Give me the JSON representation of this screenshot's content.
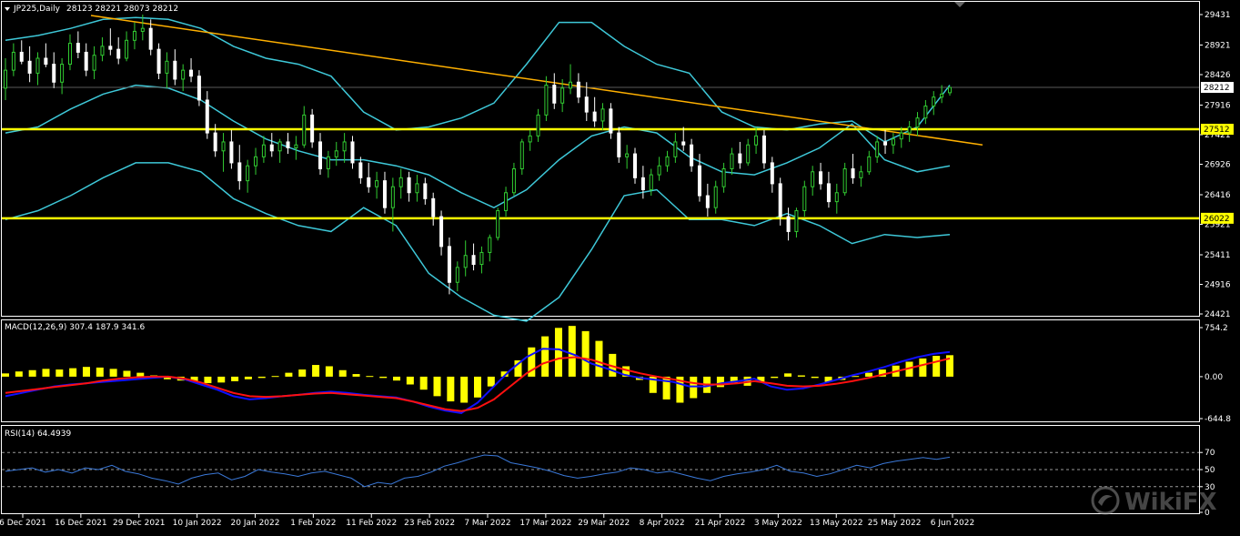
{
  "colors": {
    "bull": "#32cd32",
    "bear": "#ffffff",
    "bands": "#3ec8d8",
    "trendline": "#ffb000",
    "hline": "#ffff00",
    "macd_hist": "#ffff00",
    "macd_line": "#1010ff",
    "macd_signal": "#ff1010",
    "rsi": "#3a78d8",
    "border": "#ffffff"
  },
  "main_header": {
    "symbol": "JP225,Daily",
    "ohlc": "28123 28221 28073 28212"
  },
  "macd_header": {
    "label": "MACD(12,26,9) 307.4 187.9 341.6"
  },
  "rsi_header": {
    "label": "RSI(14) 64.4939"
  },
  "price_axis": [
    "29431",
    "28921",
    "28426",
    "27916",
    "27421",
    "26926",
    "26416",
    "25921",
    "25411",
    "24916",
    "24421"
  ],
  "current_price_tag": "28212",
  "hline_tags": [
    "27512",
    "26022"
  ],
  "macd_axis": [
    "754.2",
    "0.00",
    "-644.8"
  ],
  "rsi_axis": [
    "70",
    "50",
    "30",
    "0"
  ],
  "date_axis": [
    "6 Dec 2021",
    "16 Dec 2021",
    "29 Dec 2021",
    "10 Jan 2022",
    "20 Jan 2022",
    "1 Feb 2022",
    "11 Feb 2022",
    "23 Feb 2022",
    "7 Mar 2022",
    "17 Mar 2022",
    "29 Mar 2022",
    "8 Apr 2022",
    "21 Apr 2022",
    "3 May 2022",
    "13 May 2022",
    "25 May 2022",
    "6 Jun 2022"
  ],
  "watermark": "WikiFX",
  "chart_data": [
    {
      "type": "candlestick",
      "symbol": "JP225",
      "timeframe": "Daily",
      "ylim": [
        24421,
        29431
      ],
      "overlays": [
        "Bollinger Bands",
        "Trendline",
        "Horizontal lines 27512 and 26022"
      ],
      "horizontal_lines": [
        27512,
        26022
      ],
      "trendline": {
        "from": [
          "16 Dec 2021",
          29431
        ],
        "to": [
          "8 Jun 2022",
          27250
        ]
      },
      "bollinger": {
        "upper": [
          29000,
          29080,
          29200,
          29350,
          29380,
          29350,
          29200,
          28900,
          28700,
          28600,
          28400,
          27800,
          27500,
          27550,
          27700,
          27950,
          28600,
          29300,
          29300,
          28900,
          28600,
          28450,
          27800,
          27550,
          27500,
          27600,
          27650,
          27300,
          27550,
          28250
        ],
        "middle": [
          27450,
          27550,
          27850,
          28100,
          28250,
          28200,
          28000,
          27650,
          27350,
          27150,
          27000,
          27000,
          26900,
          26750,
          26450,
          26200,
          26500,
          27000,
          27400,
          27550,
          27450,
          27050,
          26800,
          26750,
          26950,
          27200,
          27600,
          27000,
          26800,
          26900
        ],
        "lower": [
          26000,
          26150,
          26400,
          26700,
          26950,
          26950,
          26800,
          26350,
          26100,
          25900,
          25800,
          26200,
          25900,
          25100,
          24700,
          24400,
          24300,
          24700,
          25500,
          26400,
          26500,
          26000,
          26000,
          25900,
          26100,
          25900,
          25600,
          25750,
          25700,
          25750
        ]
      },
      "candles": [
        {
          "o": 28200,
          "h": 28700,
          "l": 28000,
          "c": 28500
        },
        {
          "o": 28500,
          "h": 28950,
          "l": 28400,
          "c": 28800
        },
        {
          "o": 28800,
          "h": 29000,
          "l": 28600,
          "c": 28650
        },
        {
          "o": 28650,
          "h": 28900,
          "l": 28300,
          "c": 28450
        },
        {
          "o": 28450,
          "h": 28800,
          "l": 28250,
          "c": 28700
        },
        {
          "o": 28700,
          "h": 28950,
          "l": 28550,
          "c": 28600
        },
        {
          "o": 28600,
          "h": 28800,
          "l": 28200,
          "c": 28300
        },
        {
          "o": 28300,
          "h": 28700,
          "l": 28100,
          "c": 28600
        },
        {
          "o": 28600,
          "h": 29100,
          "l": 28500,
          "c": 28950
        },
        {
          "o": 28950,
          "h": 29150,
          "l": 28700,
          "c": 28800
        },
        {
          "o": 28800,
          "h": 28950,
          "l": 28400,
          "c": 28500
        },
        {
          "o": 28500,
          "h": 28900,
          "l": 28350,
          "c": 28750
        },
        {
          "o": 28750,
          "h": 29050,
          "l": 28650,
          "c": 28900
        },
        {
          "o": 28900,
          "h": 29200,
          "l": 28750,
          "c": 28850
        },
        {
          "o": 28850,
          "h": 29050,
          "l": 28600,
          "c": 28700
        },
        {
          "o": 28700,
          "h": 29150,
          "l": 28650,
          "c": 29000
        },
        {
          "o": 29000,
          "h": 29300,
          "l": 28850,
          "c": 29150
        },
        {
          "o": 29150,
          "h": 29431,
          "l": 29000,
          "c": 29200
        },
        {
          "o": 29200,
          "h": 29350,
          "l": 28750,
          "c": 28850
        },
        {
          "o": 28850,
          "h": 28950,
          "l": 28350,
          "c": 28450
        },
        {
          "o": 28450,
          "h": 28800,
          "l": 28200,
          "c": 28650
        },
        {
          "o": 28650,
          "h": 28850,
          "l": 28250,
          "c": 28350
        },
        {
          "o": 28350,
          "h": 28600,
          "l": 28150,
          "c": 28500
        },
        {
          "o": 28500,
          "h": 28700,
          "l": 28300,
          "c": 28400
        },
        {
          "o": 28400,
          "h": 28500,
          "l": 27900,
          "c": 28000
        },
        {
          "o": 28000,
          "h": 28150,
          "l": 27350,
          "c": 27450
        },
        {
          "o": 27450,
          "h": 27600,
          "l": 27050,
          "c": 27150
        },
        {
          "o": 27150,
          "h": 27450,
          "l": 26800,
          "c": 27300
        },
        {
          "o": 27300,
          "h": 27500,
          "l": 26850,
          "c": 26950
        },
        {
          "o": 26950,
          "h": 27250,
          "l": 26500,
          "c": 26650
        },
        {
          "o": 26650,
          "h": 27000,
          "l": 26450,
          "c": 26900
        },
        {
          "o": 26900,
          "h": 27200,
          "l": 26750,
          "c": 27050
        },
        {
          "o": 27050,
          "h": 27400,
          "l": 26950,
          "c": 27250
        },
        {
          "o": 27250,
          "h": 27450,
          "l": 27050,
          "c": 27150
        },
        {
          "o": 27150,
          "h": 27350,
          "l": 26950,
          "c": 27300
        },
        {
          "o": 27300,
          "h": 27450,
          "l": 27100,
          "c": 27200
        },
        {
          "o": 27200,
          "h": 27400,
          "l": 27000,
          "c": 27250
        },
        {
          "o": 27250,
          "h": 27900,
          "l": 27200,
          "c": 27750
        },
        {
          "o": 27750,
          "h": 27850,
          "l": 27200,
          "c": 27300
        },
        {
          "o": 27300,
          "h": 27450,
          "l": 26750,
          "c": 26850
        },
        {
          "o": 26850,
          "h": 27150,
          "l": 26700,
          "c": 27050
        },
        {
          "o": 27050,
          "h": 27300,
          "l": 26900,
          "c": 27150
        },
        {
          "o": 27150,
          "h": 27450,
          "l": 26950,
          "c": 27300
        },
        {
          "o": 27300,
          "h": 27400,
          "l": 26850,
          "c": 26950
        },
        {
          "o": 26950,
          "h": 27050,
          "l": 26600,
          "c": 26700
        },
        {
          "o": 26700,
          "h": 26950,
          "l": 26450,
          "c": 26550
        },
        {
          "o": 26550,
          "h": 26800,
          "l": 26350,
          "c": 26650
        },
        {
          "o": 26650,
          "h": 26800,
          "l": 26100,
          "c": 26200
        },
        {
          "o": 26200,
          "h": 26700,
          "l": 25800,
          "c": 26550
        },
        {
          "o": 26550,
          "h": 26850,
          "l": 26350,
          "c": 26700
        },
        {
          "o": 26700,
          "h": 26800,
          "l": 26300,
          "c": 26450
        },
        {
          "o": 26450,
          "h": 26750,
          "l": 26300,
          "c": 26600
        },
        {
          "o": 26600,
          "h": 26700,
          "l": 26250,
          "c": 26350
        },
        {
          "o": 26350,
          "h": 26450,
          "l": 25900,
          "c": 26050
        },
        {
          "o": 26050,
          "h": 26150,
          "l": 25400,
          "c": 25550
        },
        {
          "o": 25550,
          "h": 25700,
          "l": 24750,
          "c": 24950
        },
        {
          "o": 24950,
          "h": 25300,
          "l": 24800,
          "c": 25200
        },
        {
          "o": 25200,
          "h": 25650,
          "l": 25050,
          "c": 25400
        },
        {
          "o": 25400,
          "h": 25600,
          "l": 25150,
          "c": 25250
        },
        {
          "o": 25250,
          "h": 25550,
          "l": 25100,
          "c": 25450
        },
        {
          "o": 25450,
          "h": 25750,
          "l": 25300,
          "c": 25700
        },
        {
          "o": 25700,
          "h": 26200,
          "l": 25650,
          "c": 26150
        },
        {
          "o": 26150,
          "h": 26550,
          "l": 26050,
          "c": 26450
        },
        {
          "o": 26450,
          "h": 26950,
          "l": 26400,
          "c": 26850
        },
        {
          "o": 26850,
          "h": 27350,
          "l": 26750,
          "c": 27300
        },
        {
          "o": 27300,
          "h": 27500,
          "l": 27150,
          "c": 27400
        },
        {
          "o": 27400,
          "h": 27850,
          "l": 27300,
          "c": 27750
        },
        {
          "o": 27750,
          "h": 28400,
          "l": 27650,
          "c": 28250
        },
        {
          "o": 28250,
          "h": 28450,
          "l": 27850,
          "c": 27950
        },
        {
          "o": 27950,
          "h": 28350,
          "l": 27800,
          "c": 28200
        },
        {
          "o": 28200,
          "h": 28600,
          "l": 28100,
          "c": 28300
        },
        {
          "o": 28300,
          "h": 28450,
          "l": 27950,
          "c": 28050
        },
        {
          "o": 28050,
          "h": 28300,
          "l": 27650,
          "c": 27800
        },
        {
          "o": 27800,
          "h": 28050,
          "l": 27550,
          "c": 27650
        },
        {
          "o": 27650,
          "h": 27950,
          "l": 27500,
          "c": 27850
        },
        {
          "o": 27850,
          "h": 27950,
          "l": 27350,
          "c": 27450
        },
        {
          "o": 27450,
          "h": 27550,
          "l": 26950,
          "c": 27050
        },
        {
          "o": 27050,
          "h": 27250,
          "l": 26850,
          "c": 27100
        },
        {
          "o": 27100,
          "h": 27200,
          "l": 26600,
          "c": 26700
        },
        {
          "o": 26700,
          "h": 26900,
          "l": 26350,
          "c": 26500
        },
        {
          "o": 26500,
          "h": 26850,
          "l": 26400,
          "c": 26750
        },
        {
          "o": 26750,
          "h": 27050,
          "l": 26650,
          "c": 26900
        },
        {
          "o": 26900,
          "h": 27150,
          "l": 26800,
          "c": 27050
        },
        {
          "o": 27050,
          "h": 27450,
          "l": 26950,
          "c": 27300
        },
        {
          "o": 27300,
          "h": 27550,
          "l": 27150,
          "c": 27250
        },
        {
          "o": 27250,
          "h": 27350,
          "l": 26800,
          "c": 26900
        },
        {
          "o": 26900,
          "h": 27100,
          "l": 26300,
          "c": 26400
        },
        {
          "o": 26400,
          "h": 26600,
          "l": 26050,
          "c": 26200
        },
        {
          "o": 26200,
          "h": 26650,
          "l": 26100,
          "c": 26550
        },
        {
          "o": 26550,
          "h": 26950,
          "l": 26450,
          "c": 26850
        },
        {
          "o": 26850,
          "h": 27200,
          "l": 26750,
          "c": 27100
        },
        {
          "o": 27100,
          "h": 27300,
          "l": 26850,
          "c": 26950
        },
        {
          "o": 26950,
          "h": 27350,
          "l": 26900,
          "c": 27250
        },
        {
          "o": 27250,
          "h": 27550,
          "l": 27100,
          "c": 27400
        },
        {
          "o": 27400,
          "h": 27500,
          "l": 26850,
          "c": 26950
        },
        {
          "o": 26950,
          "h": 27050,
          "l": 26450,
          "c": 26600
        },
        {
          "o": 26600,
          "h": 26700,
          "l": 25900,
          "c": 26050
        },
        {
          "o": 26050,
          "h": 26200,
          "l": 25650,
          "c": 25800
        },
        {
          "o": 25800,
          "h": 26200,
          "l": 25700,
          "c": 26150
        },
        {
          "o": 26150,
          "h": 26650,
          "l": 26050,
          "c": 26550
        },
        {
          "o": 26550,
          "h": 26900,
          "l": 26400,
          "c": 26800
        },
        {
          "o": 26800,
          "h": 26950,
          "l": 26500,
          "c": 26600
        },
        {
          "o": 26600,
          "h": 26800,
          "l": 26200,
          "c": 26300
        },
        {
          "o": 26300,
          "h": 26600,
          "l": 26100,
          "c": 26450
        },
        {
          "o": 26450,
          "h": 26950,
          "l": 26400,
          "c": 26850
        },
        {
          "o": 26850,
          "h": 27100,
          "l": 26600,
          "c": 26700
        },
        {
          "o": 26700,
          "h": 26900,
          "l": 26550,
          "c": 26800
        },
        {
          "o": 26800,
          "h": 27150,
          "l": 26750,
          "c": 27050
        },
        {
          "o": 27050,
          "h": 27400,
          "l": 26950,
          "c": 27300
        },
        {
          "o": 27300,
          "h": 27500,
          "l": 27100,
          "c": 27250
        },
        {
          "o": 27250,
          "h": 27450,
          "l": 27100,
          "c": 27350
        },
        {
          "o": 27350,
          "h": 27550,
          "l": 27200,
          "c": 27450
        },
        {
          "o": 27450,
          "h": 27650,
          "l": 27300,
          "c": 27550
        },
        {
          "o": 27550,
          "h": 27800,
          "l": 27400,
          "c": 27700
        },
        {
          "o": 27700,
          "h": 28000,
          "l": 27600,
          "c": 27900
        },
        {
          "o": 27900,
          "h": 28150,
          "l": 27750,
          "c": 28050
        },
        {
          "o": 28050,
          "h": 28250,
          "l": 27950,
          "c": 28100
        },
        {
          "o": 28123,
          "h": 28221,
          "l": 28073,
          "c": 28212
        }
      ]
    },
    {
      "type": "bar",
      "name": "MACD(12,26,9)",
      "ylim": [
        -644.8,
        754.2
      ],
      "histogram": [
        50,
        80,
        100,
        120,
        110,
        130,
        150,
        140,
        120,
        90,
        60,
        20,
        -40,
        -60,
        -80,
        -100,
        -90,
        -70,
        -40,
        -20,
        10,
        60,
        110,
        180,
        160,
        100,
        40,
        10,
        -20,
        -60,
        -120,
        -200,
        -300,
        -380,
        -400,
        -320,
        -150,
        80,
        250,
        450,
        620,
        750,
        780,
        700,
        550,
        350,
        160,
        -50,
        -250,
        -350,
        -400,
        -330,
        -250,
        -160,
        -100,
        -140,
        -80,
        -20,
        50,
        20,
        -20,
        -80,
        -50,
        10,
        60,
        110,
        170,
        230,
        280,
        320,
        330
      ],
      "macd": [
        -300,
        -250,
        -200,
        -150,
        -120,
        -100,
        -80,
        -60,
        -40,
        -20,
        0,
        -40,
        -120,
        -200,
        -300,
        -350,
        -330,
        -300,
        -280,
        -250,
        -230,
        -250,
        -280,
        -300,
        -320,
        -380,
        -460,
        -520,
        -560,
        -400,
        -150,
        100,
        300,
        430,
        420,
        330,
        200,
        120,
        30,
        -20,
        -50,
        -80,
        -150,
        -150,
        -100,
        -70,
        -30,
        -150,
        -200,
        -180,
        -120,
        -50,
        20,
        80,
        150,
        230,
        300,
        350,
        380
      ],
      "signal": [
        -250,
        -220,
        -190,
        -160,
        -130,
        -100,
        -60,
        -30,
        -10,
        0,
        0,
        -30,
        -90,
        -170,
        -250,
        -300,
        -310,
        -300,
        -280,
        -260,
        -250,
        -270,
        -290,
        -310,
        -330,
        -380,
        -440,
        -500,
        -530,
        -480,
        -350,
        -150,
        50,
        200,
        280,
        300,
        260,
        180,
        110,
        50,
        0,
        -40,
        -90,
        -120,
        -120,
        -100,
        -70,
        -100,
        -140,
        -150,
        -140,
        -110,
        -70,
        -20,
        40,
        100,
        160,
        220,
        280
      ]
    },
    {
      "type": "line",
      "name": "RSI(14)",
      "ylim": [
        0,
        100
      ],
      "levels": [
        70,
        50,
        30
      ],
      "values": [
        48,
        50,
        52,
        47,
        50,
        46,
        52,
        50,
        55,
        48,
        45,
        40,
        37,
        33,
        40,
        44,
        46,
        38,
        42,
        50,
        47,
        45,
        42,
        46,
        48,
        44,
        40,
        30,
        35,
        33,
        40,
        42,
        47,
        54,
        58,
        63,
        67,
        66,
        58,
        55,
        52,
        48,
        43,
        40,
        42,
        45,
        47,
        52,
        50,
        46,
        48,
        44,
        40,
        37,
        42,
        45,
        47,
        50,
        55,
        48,
        46,
        42,
        45,
        50,
        55,
        52,
        57,
        60,
        62,
        64,
        62,
        64.49
      ]
    }
  ]
}
